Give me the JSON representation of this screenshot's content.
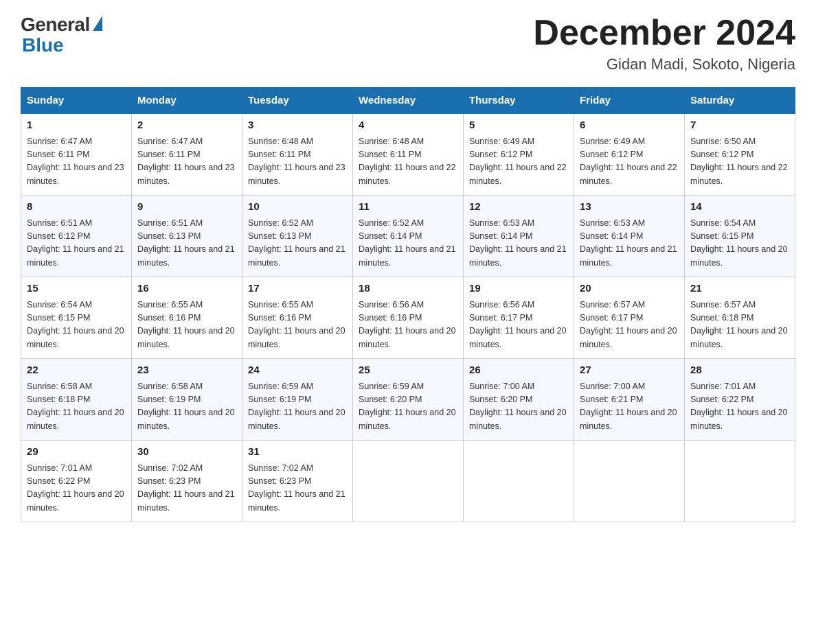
{
  "header": {
    "logo_general": "General",
    "logo_blue": "Blue",
    "month_title": "December 2024",
    "location": "Gidan Madi, Sokoto, Nigeria"
  },
  "days_of_week": [
    "Sunday",
    "Monday",
    "Tuesday",
    "Wednesday",
    "Thursday",
    "Friday",
    "Saturday"
  ],
  "weeks": [
    [
      {
        "day": "1",
        "sunrise": "6:47 AM",
        "sunset": "6:11 PM",
        "daylight": "11 hours and 23 minutes."
      },
      {
        "day": "2",
        "sunrise": "6:47 AM",
        "sunset": "6:11 PM",
        "daylight": "11 hours and 23 minutes."
      },
      {
        "day": "3",
        "sunrise": "6:48 AM",
        "sunset": "6:11 PM",
        "daylight": "11 hours and 23 minutes."
      },
      {
        "day": "4",
        "sunrise": "6:48 AM",
        "sunset": "6:11 PM",
        "daylight": "11 hours and 22 minutes."
      },
      {
        "day": "5",
        "sunrise": "6:49 AM",
        "sunset": "6:12 PM",
        "daylight": "11 hours and 22 minutes."
      },
      {
        "day": "6",
        "sunrise": "6:49 AM",
        "sunset": "6:12 PM",
        "daylight": "11 hours and 22 minutes."
      },
      {
        "day": "7",
        "sunrise": "6:50 AM",
        "sunset": "6:12 PM",
        "daylight": "11 hours and 22 minutes."
      }
    ],
    [
      {
        "day": "8",
        "sunrise": "6:51 AM",
        "sunset": "6:12 PM",
        "daylight": "11 hours and 21 minutes."
      },
      {
        "day": "9",
        "sunrise": "6:51 AM",
        "sunset": "6:13 PM",
        "daylight": "11 hours and 21 minutes."
      },
      {
        "day": "10",
        "sunrise": "6:52 AM",
        "sunset": "6:13 PM",
        "daylight": "11 hours and 21 minutes."
      },
      {
        "day": "11",
        "sunrise": "6:52 AM",
        "sunset": "6:14 PM",
        "daylight": "11 hours and 21 minutes."
      },
      {
        "day": "12",
        "sunrise": "6:53 AM",
        "sunset": "6:14 PM",
        "daylight": "11 hours and 21 minutes."
      },
      {
        "day": "13",
        "sunrise": "6:53 AM",
        "sunset": "6:14 PM",
        "daylight": "11 hours and 21 minutes."
      },
      {
        "day": "14",
        "sunrise": "6:54 AM",
        "sunset": "6:15 PM",
        "daylight": "11 hours and 20 minutes."
      }
    ],
    [
      {
        "day": "15",
        "sunrise": "6:54 AM",
        "sunset": "6:15 PM",
        "daylight": "11 hours and 20 minutes."
      },
      {
        "day": "16",
        "sunrise": "6:55 AM",
        "sunset": "6:16 PM",
        "daylight": "11 hours and 20 minutes."
      },
      {
        "day": "17",
        "sunrise": "6:55 AM",
        "sunset": "6:16 PM",
        "daylight": "11 hours and 20 minutes."
      },
      {
        "day": "18",
        "sunrise": "6:56 AM",
        "sunset": "6:16 PM",
        "daylight": "11 hours and 20 minutes."
      },
      {
        "day": "19",
        "sunrise": "6:56 AM",
        "sunset": "6:17 PM",
        "daylight": "11 hours and 20 minutes."
      },
      {
        "day": "20",
        "sunrise": "6:57 AM",
        "sunset": "6:17 PM",
        "daylight": "11 hours and 20 minutes."
      },
      {
        "day": "21",
        "sunrise": "6:57 AM",
        "sunset": "6:18 PM",
        "daylight": "11 hours and 20 minutes."
      }
    ],
    [
      {
        "day": "22",
        "sunrise": "6:58 AM",
        "sunset": "6:18 PM",
        "daylight": "11 hours and 20 minutes."
      },
      {
        "day": "23",
        "sunrise": "6:58 AM",
        "sunset": "6:19 PM",
        "daylight": "11 hours and 20 minutes."
      },
      {
        "day": "24",
        "sunrise": "6:59 AM",
        "sunset": "6:19 PM",
        "daylight": "11 hours and 20 minutes."
      },
      {
        "day": "25",
        "sunrise": "6:59 AM",
        "sunset": "6:20 PM",
        "daylight": "11 hours and 20 minutes."
      },
      {
        "day": "26",
        "sunrise": "7:00 AM",
        "sunset": "6:20 PM",
        "daylight": "11 hours and 20 minutes."
      },
      {
        "day": "27",
        "sunrise": "7:00 AM",
        "sunset": "6:21 PM",
        "daylight": "11 hours and 20 minutes."
      },
      {
        "day": "28",
        "sunrise": "7:01 AM",
        "sunset": "6:22 PM",
        "daylight": "11 hours and 20 minutes."
      }
    ],
    [
      {
        "day": "29",
        "sunrise": "7:01 AM",
        "sunset": "6:22 PM",
        "daylight": "11 hours and 20 minutes."
      },
      {
        "day": "30",
        "sunrise": "7:02 AM",
        "sunset": "6:23 PM",
        "daylight": "11 hours and 21 minutes."
      },
      {
        "day": "31",
        "sunrise": "7:02 AM",
        "sunset": "6:23 PM",
        "daylight": "11 hours and 21 minutes."
      },
      null,
      null,
      null,
      null
    ]
  ]
}
